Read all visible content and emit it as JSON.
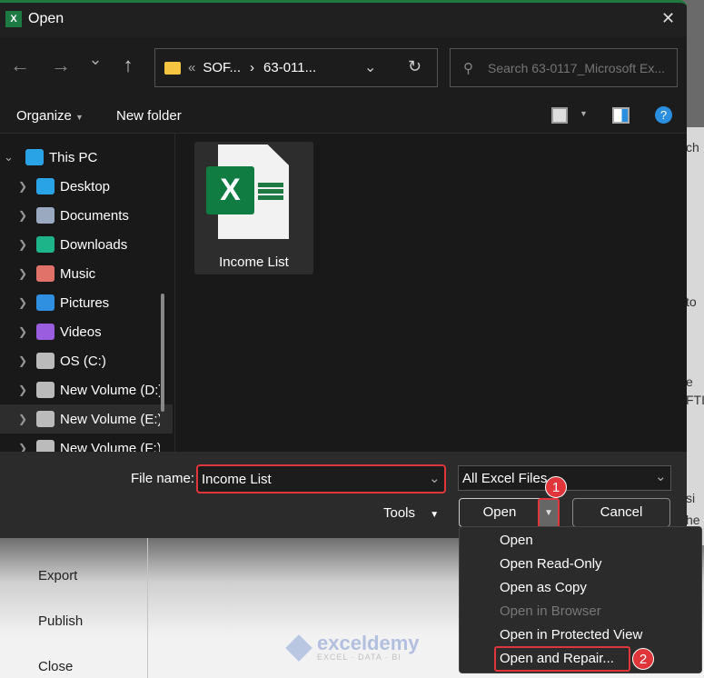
{
  "dialog": {
    "title": "Open",
    "close": "✕"
  },
  "nav": {
    "back": "←",
    "forward": "→",
    "recent": "⌄",
    "up": "↑",
    "address": {
      "overflow": "«",
      "crumbs": [
        "SOF...",
        "63-011..."
      ],
      "sep": "›"
    },
    "search_placeholder": "Search 63-0117_Microsoft Ex..."
  },
  "toolbar": {
    "organize": "Organize",
    "new_folder": "New folder",
    "help": "?"
  },
  "sidebar": {
    "root": "This PC",
    "items": [
      {
        "label": "Desktop",
        "color": "#29a3e6"
      },
      {
        "label": "Documents",
        "color": "#9aa9c0"
      },
      {
        "label": "Downloads",
        "color": "#1db48a"
      },
      {
        "label": "Music",
        "color": "#e0726a"
      },
      {
        "label": "Pictures",
        "color": "#2f8fe0"
      },
      {
        "label": "Videos",
        "color": "#9b5de0"
      },
      {
        "label": "OS (C:)",
        "color": "#bbbbbb"
      },
      {
        "label": "New Volume (D:)",
        "color": "#bbbbbb"
      },
      {
        "label": "New Volume (E:)",
        "color": "#bbbbbb"
      },
      {
        "label": "New Volume (F:)",
        "color": "#bbbbbb"
      }
    ]
  },
  "files": [
    {
      "name": "Income List",
      "icon": "X"
    }
  ],
  "bottom": {
    "file_name_label": "File name:",
    "file_name_value": "Income List",
    "file_type": "All Excel Files",
    "tools": "Tools",
    "open": "Open",
    "cancel": "Cancel"
  },
  "open_menu": [
    "Open",
    "Open Read-Only",
    "Open as Copy",
    "Open in Browser",
    "Open in Protected View",
    "Open and Repair..."
  ],
  "callouts": [
    "1",
    "2"
  ],
  "background": {
    "nav": [
      "Export",
      "Publish",
      "Close"
    ],
    "fragments": [
      "ch",
      "to",
      "e",
      "FTI",
      "si",
      "he"
    ],
    "watermark": "exceldemy",
    "watermark_sub": "EXCEL · DATA · BI"
  }
}
